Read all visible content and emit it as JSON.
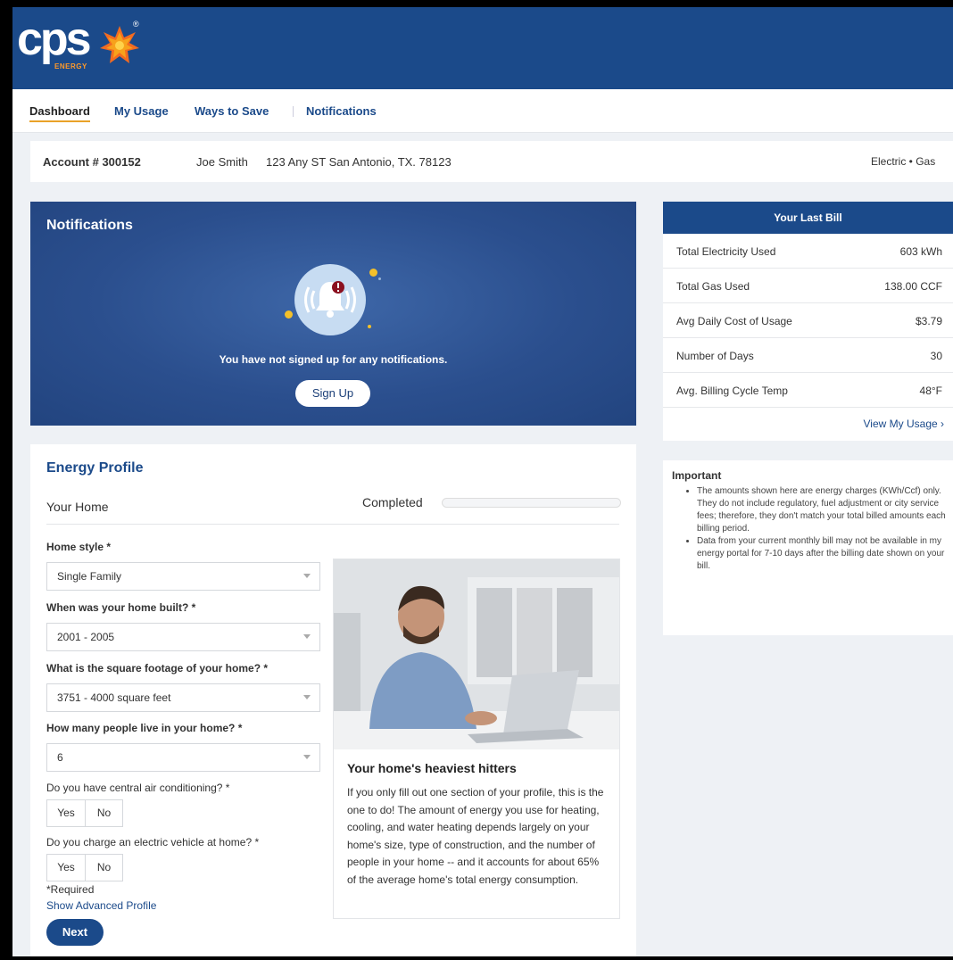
{
  "brand": {
    "logo_text": "cps",
    "logo_sub": "ENERGY"
  },
  "nav": {
    "items": [
      {
        "label": "Dashboard",
        "active": true
      },
      {
        "label": "My Usage"
      },
      {
        "label": "Ways to Save"
      },
      {
        "label": "Notifications"
      }
    ]
  },
  "account": {
    "number": "Account # 300152",
    "name": "Joe Smith",
    "address": "123 Any ST San Antonio, TX. 78123",
    "services": "Electric • Gas"
  },
  "notifications": {
    "title": "Notifications",
    "message": "You have not signed up for any notifications.",
    "signup_label": "Sign Up"
  },
  "last_bill": {
    "title": "Your Last Bill",
    "rows": [
      {
        "label": "Total Electricity Used",
        "value": "603 kWh"
      },
      {
        "label": "Total Gas Used",
        "value": "138.00 CCF"
      },
      {
        "label": "Avg Daily Cost of Usage",
        "value": "$3.79"
      },
      {
        "label": "Number of Days",
        "value": "30"
      },
      {
        "label": "Avg. Billing Cycle Temp",
        "value": "48°F"
      }
    ],
    "link": "View My Usage ›"
  },
  "important": {
    "title": "Important",
    "items": [
      "The amounts shown here are energy charges (KWh/Ccf) only. They do not include regulatory, fuel adjustment or city service fees; therefore, they don't match your total billed amounts each billing period.",
      "Data from your current monthly bill may not be available in my energy portal for 7-10 days after the billing date shown on your bill."
    ]
  },
  "profile": {
    "title": "Energy Profile",
    "section": "Your Home",
    "completed_label": "Completed",
    "completed_fraction": 0,
    "questions": {
      "home_style": {
        "label": "Home style *",
        "value": "Single Family"
      },
      "built": {
        "label": "When was your home built? *",
        "value": "2001 - 2005"
      },
      "sqft": {
        "label": "What is the square footage of your home? *",
        "value": "3751 - 4000 square feet"
      },
      "people": {
        "label": "How many people live in your home? *",
        "value": "6"
      },
      "ac": {
        "label": "Do you have central air conditioning? *",
        "yes": "Yes",
        "no": "No"
      },
      "ev": {
        "label": "Do you charge an electric vehicle at home? *",
        "yes": "Yes",
        "no": "No"
      }
    },
    "required_note": "*Required",
    "advanced_link": "Show Advanced Profile",
    "next_label": "Next",
    "card": {
      "title": "Your home's heaviest hitters",
      "body": "If you only fill out one section of your profile, this is the one to do! The amount of energy you use for heating, cooling, and water heating depends largely on your home's size, type of construction, and the number of people in your home -- and it accounts for about 65% of the average home's total energy consumption."
    }
  },
  "colors": {
    "brand_blue": "#1b4a8a",
    "accent_orange": "#e9a228",
    "background": "#eef1f5"
  }
}
